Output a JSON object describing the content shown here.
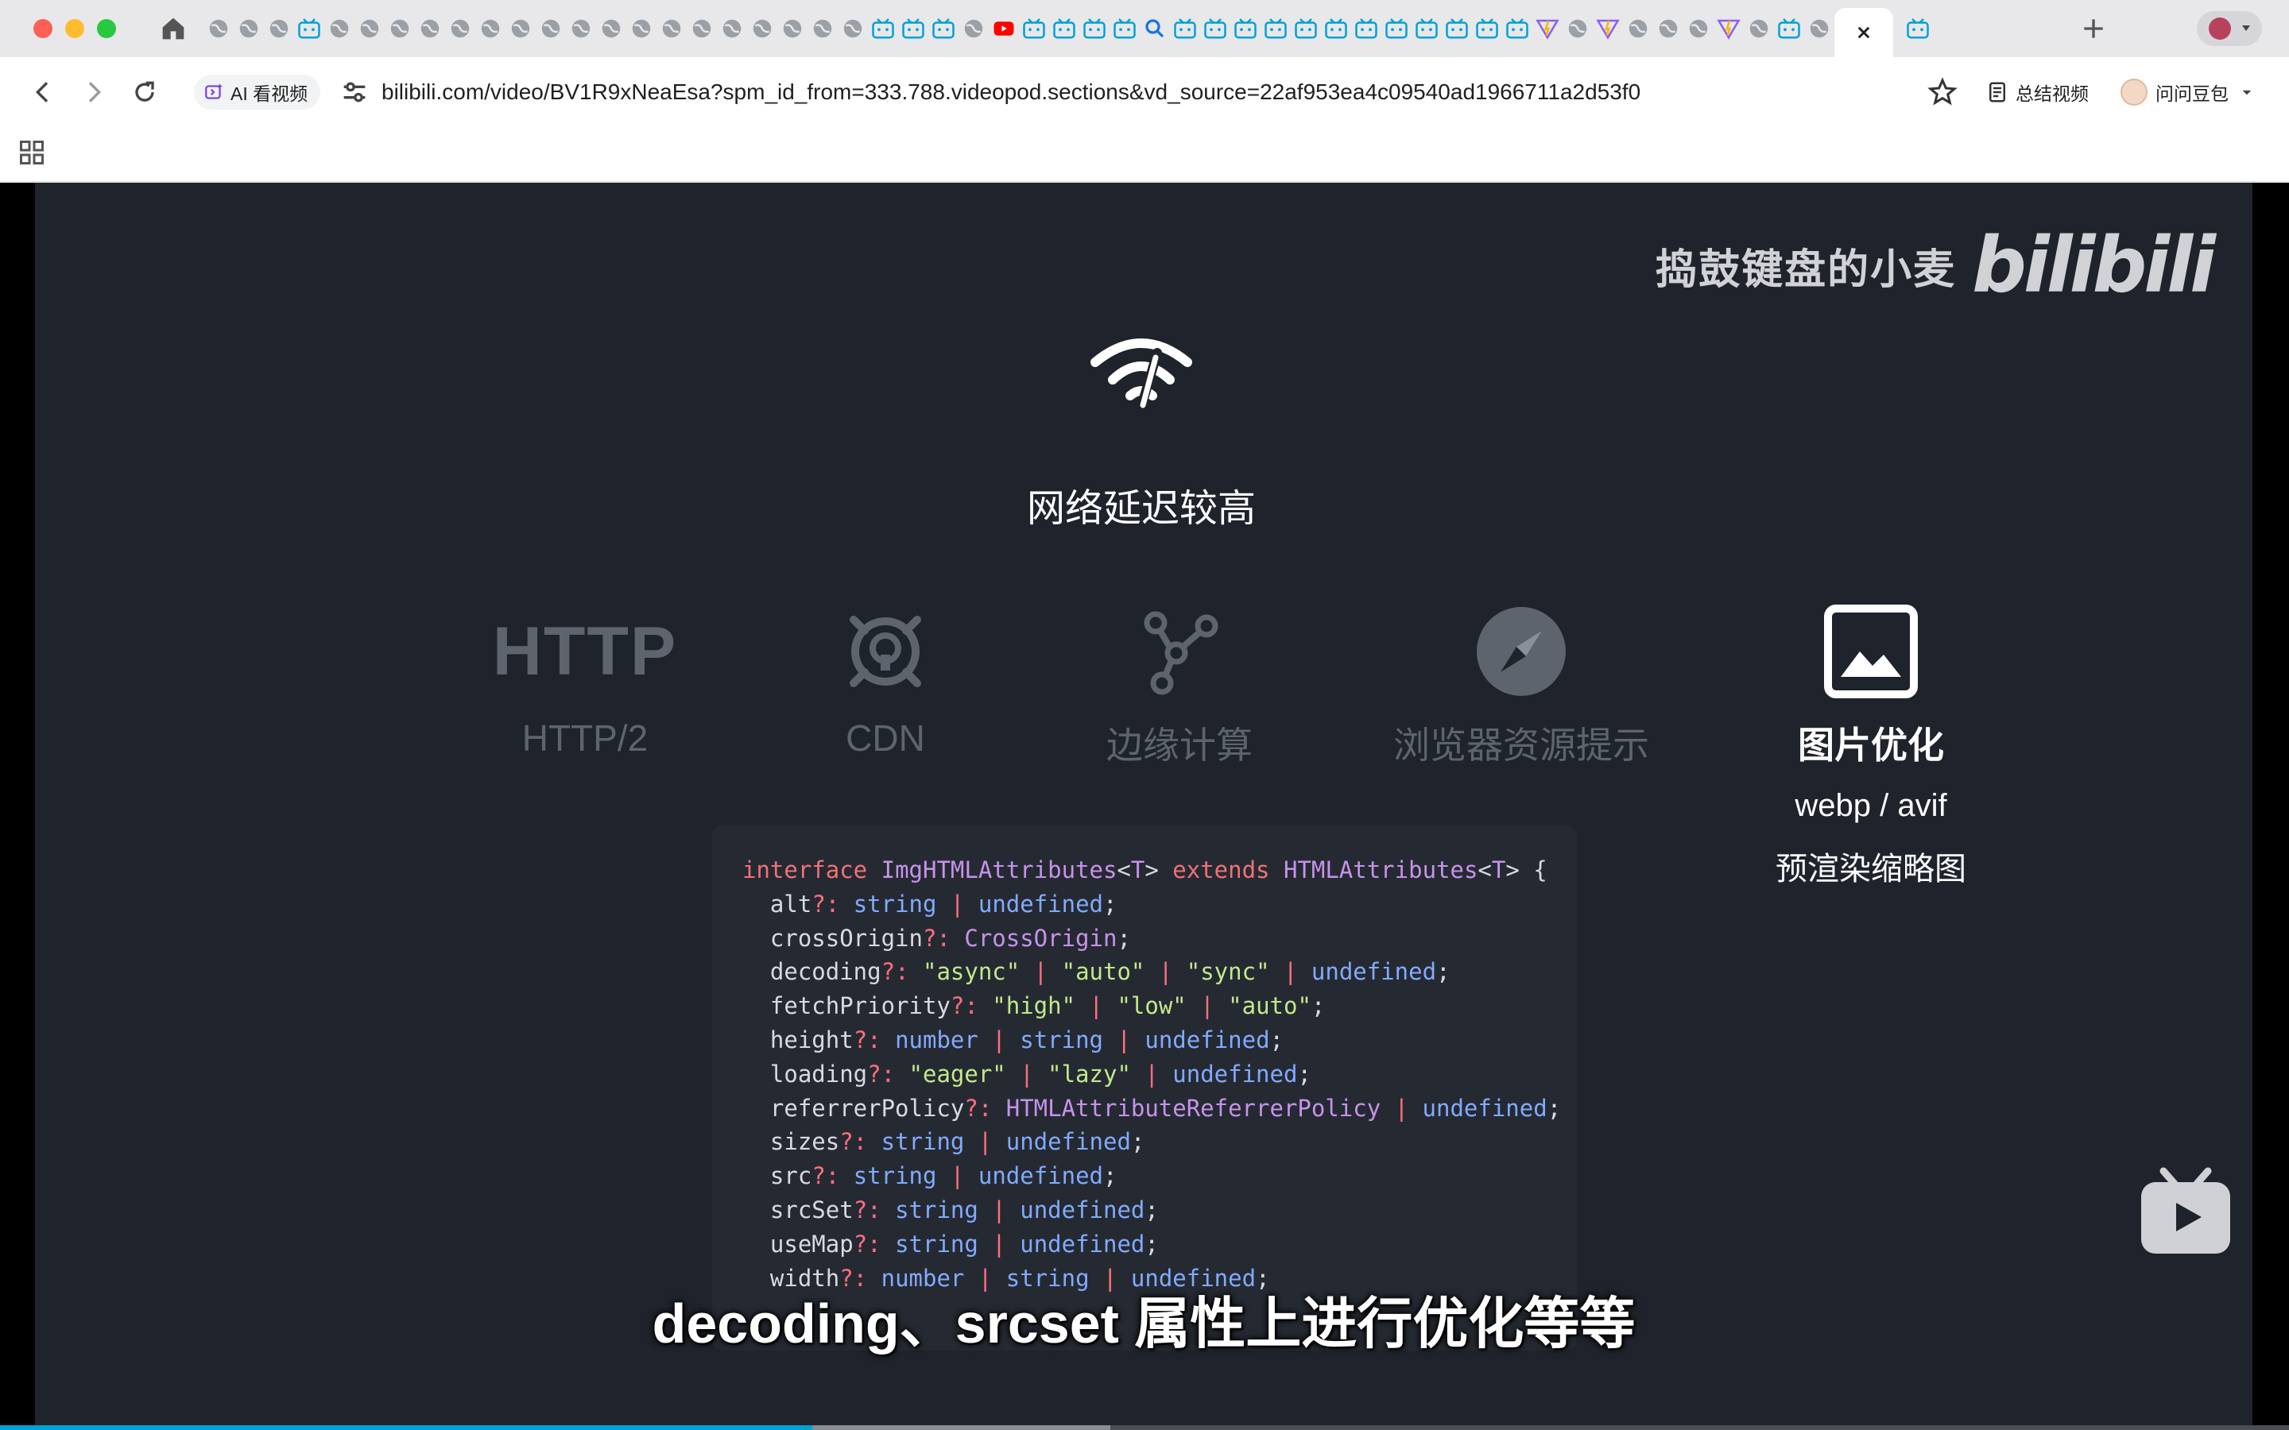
{
  "browser": {
    "tab_count_visible": 56,
    "active_tab_index": 54,
    "address_bar": {
      "ai_chip_label": "AI 看视频",
      "url": "bilibili.com/video/BV1R9xNeaEsa?spm_id_from=333.788.videopod.sections&vd_source=22af953ea4c09540ad1966711a2d53f0"
    },
    "extensions": {
      "summary_label": "总结视频",
      "doubao_label": "问问豆包"
    },
    "colors": {
      "tabstrip": "#e8e8ea",
      "toolbar": "#ffffff"
    }
  },
  "video": {
    "watermark": {
      "text": "捣鼓键盘的小麦",
      "logo": "bilibili"
    },
    "issue": {
      "icon": "wifi-slow-icon",
      "title": "网络延迟较高"
    },
    "solutions": [
      {
        "icon": "http-text-icon",
        "icon_text": "HTTP",
        "label": "HTTP/2",
        "active": false
      },
      {
        "icon": "cdn-icon",
        "label": "CDN",
        "active": false
      },
      {
        "icon": "edge-graph-icon",
        "label": "边缘计算",
        "active": false
      },
      {
        "icon": "compass-icon",
        "label": "浏览器资源提示",
        "active": false
      },
      {
        "icon": "image-icon",
        "label": "图片优化",
        "active": true,
        "details": [
          "webp / avif",
          "预渲染缩略图"
        ]
      }
    ],
    "code": [
      [
        [
          "kw",
          "interface "
        ],
        [
          "ty",
          "ImgHTMLAttributes"
        ],
        [
          "pl",
          "<"
        ],
        [
          "ty",
          "T"
        ],
        [
          "pl",
          "> "
        ],
        [
          "kw",
          "extends "
        ],
        [
          "ty",
          "HTMLAttributes"
        ],
        [
          "pl",
          "<"
        ],
        [
          "ty",
          "T"
        ],
        [
          "pl",
          "> {"
        ]
      ],
      [
        [
          "pl",
          "  alt"
        ],
        [
          "op",
          "?: "
        ],
        [
          "bt",
          "string"
        ],
        [
          "op",
          " | "
        ],
        [
          "bt",
          "undefined"
        ],
        [
          "pl",
          ";"
        ]
      ],
      [
        [
          "pl",
          "  crossOrigin"
        ],
        [
          "op",
          "?: "
        ],
        [
          "ty",
          "CrossOrigin"
        ],
        [
          "pl",
          ";"
        ]
      ],
      [
        [
          "pl",
          "  decoding"
        ],
        [
          "op",
          "?: "
        ],
        [
          "st",
          "\"async\""
        ],
        [
          "op",
          " | "
        ],
        [
          "st",
          "\"auto\""
        ],
        [
          "op",
          " | "
        ],
        [
          "st",
          "\"sync\""
        ],
        [
          "op",
          " | "
        ],
        [
          "bt",
          "undefined"
        ],
        [
          "pl",
          ";"
        ]
      ],
      [
        [
          "pl",
          "  fetchPriority"
        ],
        [
          "op",
          "?: "
        ],
        [
          "st",
          "\"high\""
        ],
        [
          "op",
          " | "
        ],
        [
          "st",
          "\"low\""
        ],
        [
          "op",
          " | "
        ],
        [
          "st",
          "\"auto\""
        ],
        [
          "pl",
          ";"
        ]
      ],
      [
        [
          "pl",
          "  height"
        ],
        [
          "op",
          "?: "
        ],
        [
          "bt",
          "number"
        ],
        [
          "op",
          " | "
        ],
        [
          "bt",
          "string"
        ],
        [
          "op",
          " | "
        ],
        [
          "bt",
          "undefined"
        ],
        [
          "pl",
          ";"
        ]
      ],
      [
        [
          "pl",
          "  loading"
        ],
        [
          "op",
          "?: "
        ],
        [
          "st",
          "\"eager\""
        ],
        [
          "op",
          " | "
        ],
        [
          "st",
          "\"lazy\""
        ],
        [
          "op",
          " | "
        ],
        [
          "bt",
          "undefined"
        ],
        [
          "pl",
          ";"
        ]
      ],
      [
        [
          "pl",
          "  referrerPolicy"
        ],
        [
          "op",
          "?: "
        ],
        [
          "ty",
          "HTMLAttributeReferrerPolicy"
        ],
        [
          "op",
          " | "
        ],
        [
          "bt",
          "undefined"
        ],
        [
          "pl",
          ";"
        ]
      ],
      [
        [
          "pl",
          "  sizes"
        ],
        [
          "op",
          "?: "
        ],
        [
          "bt",
          "string"
        ],
        [
          "op",
          " | "
        ],
        [
          "bt",
          "undefined"
        ],
        [
          "pl",
          ";"
        ]
      ],
      [
        [
          "pl",
          "  src"
        ],
        [
          "op",
          "?: "
        ],
        [
          "bt",
          "string"
        ],
        [
          "op",
          " | "
        ],
        [
          "bt",
          "undefined"
        ],
        [
          "pl",
          ";"
        ]
      ],
      [
        [
          "pl",
          "  srcSet"
        ],
        [
          "op",
          "?: "
        ],
        [
          "bt",
          "string"
        ],
        [
          "op",
          " | "
        ],
        [
          "bt",
          "undefined"
        ],
        [
          "pl",
          ";"
        ]
      ],
      [
        [
          "pl",
          "  useMap"
        ],
        [
          "op",
          "?: "
        ],
        [
          "bt",
          "string"
        ],
        [
          "op",
          " | "
        ],
        [
          "bt",
          "undefined"
        ],
        [
          "pl",
          ";"
        ]
      ],
      [
        [
          "pl",
          "  width"
        ],
        [
          "op",
          "?: "
        ],
        [
          "bt",
          "number"
        ],
        [
          "op",
          " | "
        ],
        [
          "bt",
          "string"
        ],
        [
          "op",
          " | "
        ],
        [
          "bt",
          "undefined"
        ],
        [
          "pl",
          ";"
        ]
      ]
    ],
    "subtitle": "decoding、srcset 属性上进行优化等等",
    "progress": {
      "played_fraction": 0.355,
      "buffered_fraction": 0.485
    },
    "colors": {
      "background": "#1f232b",
      "accent": "#00a1d6",
      "inactive": "#5e646d"
    }
  }
}
